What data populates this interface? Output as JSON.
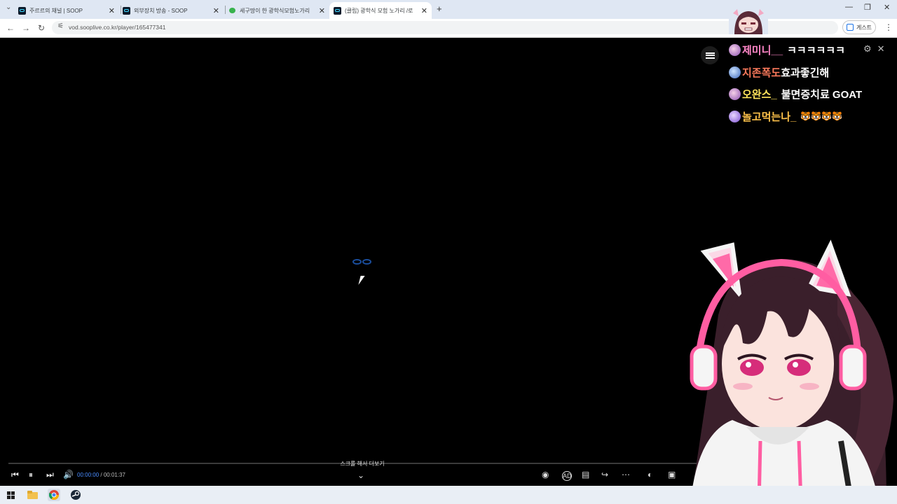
{
  "browser": {
    "tabs": [
      {
        "title": "주르르의 채널 | SOOP",
        "active": false
      },
      {
        "title": "외부장치 방송 - SOOP",
        "active": false
      },
      {
        "title": "세구땅이 한 광학식모험노가리",
        "active": false
      },
      {
        "title": "(클립) 광학식 모험 노가리 /로",
        "active": true
      }
    ],
    "url": "vod.sooplive.co.kr/player/165477341",
    "guest_label": "게스트"
  },
  "chat": {
    "messages": [
      {
        "nick": "제미니__",
        "text": "ㅋㅋㅋㅋㅋㅋ",
        "nick_color": "#ff86c8"
      },
      {
        "nick": "지존폭도",
        "text": "효과좋긴해",
        "nick_color": "#ff7a5c"
      },
      {
        "nick": "오완스_",
        "text": "불면증치료 GOAT",
        "nick_color": "#ffe45c"
      },
      {
        "nick": "놀고먹는나_",
        "text": "🐯🐯🐯🐯",
        "nick_color": "#ffc24a"
      }
    ]
  },
  "player": {
    "scroll_hint": "스크롤 해서 더보기",
    "current_time": "00:00:00",
    "duration": "/ 00:01:37",
    "progress": 0
  },
  "icons": {
    "menu": "hamburger-icon",
    "settings": "gear-icon",
    "close": "close-icon"
  }
}
